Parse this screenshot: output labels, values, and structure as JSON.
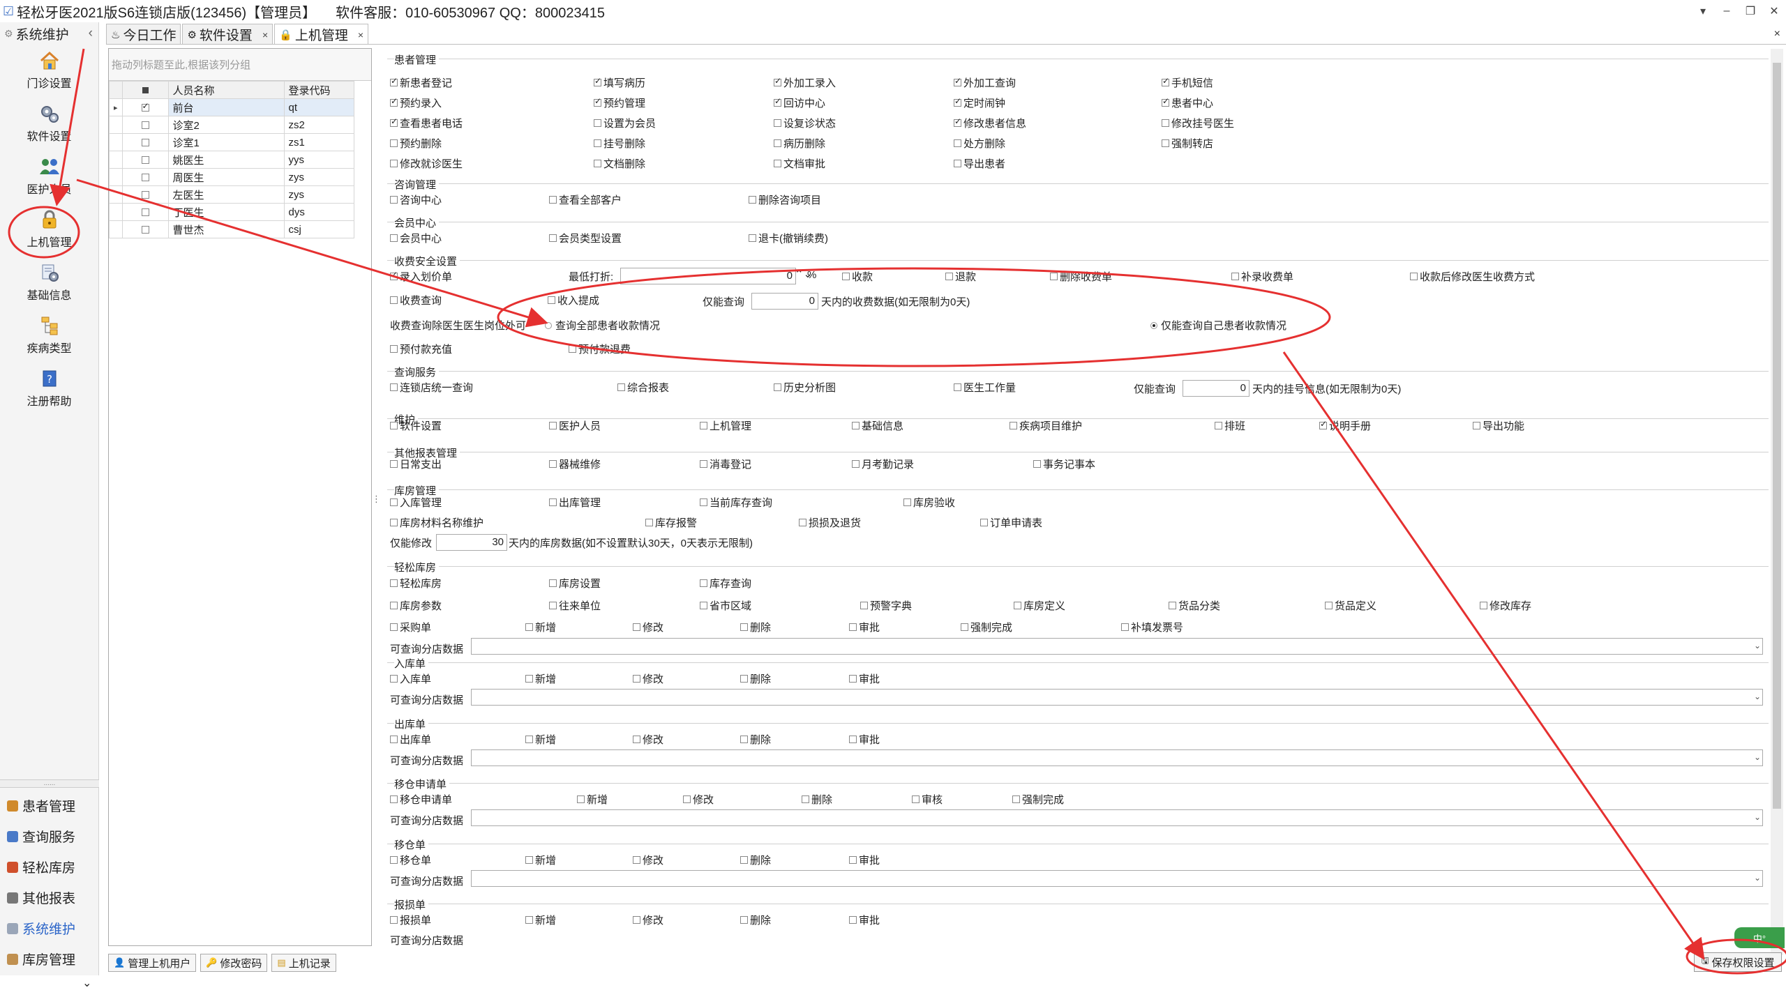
{
  "window": {
    "title": "轻松牙医2021版S6连锁店版(123456)【管理员】",
    "service": "软件客服：010-60530967 QQ：800023415",
    "controls": [
      "▾",
      "–",
      "❐",
      "✕"
    ]
  },
  "sidebar": {
    "header": "系统维护",
    "collapse": "‹",
    "icons": [
      {
        "label": "门诊设置",
        "icon": "house-icon"
      },
      {
        "label": "软件设置",
        "icon": "gears-icon"
      },
      {
        "label": "医护人员",
        "icon": "people-icon"
      },
      {
        "label": "上机管理",
        "icon": "lock-icon"
      },
      {
        "label": "基础信息",
        "icon": "settings-doc-icon"
      },
      {
        "label": "疾病类型",
        "icon": "tree-icon"
      },
      {
        "label": "注册帮助",
        "icon": "help-icon"
      }
    ],
    "grip": "......",
    "modules": [
      "患者管理",
      "查询服务",
      "轻松库房",
      "其他报表",
      "系统维护",
      "库房管理"
    ],
    "more": "⌄",
    "active_color": "#2a64c8"
  },
  "tabs": [
    {
      "label": "今日工作",
      "closable": false
    },
    {
      "label": "软件设置",
      "closable": true
    },
    {
      "label": "上机管理",
      "closable": true
    }
  ],
  "tabclose": "×",
  "users": {
    "group_hint": "拖动列标题至此,根据该列分组",
    "headers": [
      "人员名称",
      "登录代码"
    ],
    "rows": [
      {
        "name": "前台",
        "code": "qt",
        "checked": true
      },
      {
        "name": "诊室2",
        "code": "zs2",
        "checked": false
      },
      {
        "name": "诊室1",
        "code": "zs1",
        "checked": false
      },
      {
        "name": "姚医生",
        "code": "yys",
        "checked": false
      },
      {
        "name": "周医生",
        "code": "zys",
        "checked": false
      },
      {
        "name": "左医生",
        "code": "zys",
        "checked": false
      },
      {
        "name": "丁医生",
        "code": "dys",
        "checked": false
      },
      {
        "name": "曹世杰",
        "code": "csj",
        "checked": false
      }
    ],
    "current_marker": "▸"
  },
  "buttons": {
    "manage_users": "管理上机用户",
    "change_pwd": "修改密码",
    "login_log": "上机记录",
    "save": "保存权限设置"
  },
  "sections": {
    "patient": {
      "title": "患者管理",
      "items": [
        {
          "t": "新患者登记",
          "c": true
        },
        {
          "t": "填写病历",
          "c": true
        },
        {
          "t": "外加工录入",
          "c": true
        },
        {
          "t": "外加工查询",
          "c": true
        },
        {
          "t": "手机短信",
          "c": true
        },
        {
          "t": "预约录入",
          "c": true
        },
        {
          "t": "预约管理",
          "c": true
        },
        {
          "t": "回访中心",
          "c": true
        },
        {
          "t": "定时闹钟",
          "c": true
        },
        {
          "t": "患者中心",
          "c": true
        },
        {
          "t": "查看患者电话",
          "c": true
        },
        {
          "t": "设置为会员",
          "c": false
        },
        {
          "t": "设复诊状态",
          "c": false
        },
        {
          "t": "修改患者信息",
          "c": true
        },
        {
          "t": "修改挂号医生",
          "c": false
        },
        {
          "t": "预约删除",
          "c": false
        },
        {
          "t": "挂号删除",
          "c": false
        },
        {
          "t": "病历删除",
          "c": false
        },
        {
          "t": "处方删除",
          "c": false
        },
        {
          "t": "强制转店",
          "c": false
        },
        {
          "t": "修改就诊医生",
          "c": false
        },
        {
          "t": "文档删除",
          "c": false
        },
        {
          "t": "文档审批",
          "c": false
        },
        {
          "t": "导出患者",
          "c": false
        }
      ]
    },
    "consult": {
      "title": "咨询管理",
      "items": [
        "咨询中心",
        "查看全部客户",
        "删除咨询项目"
      ]
    },
    "member": {
      "title": "会员中心",
      "items": [
        "会员中心",
        "会员类型设置",
        "退卡(撤销续费)"
      ]
    },
    "fee": {
      "title": "收费安全设置",
      "entry": "录入划价单",
      "min_discount": "最低打折:",
      "min_value": "0",
      "spin": "⌃⌄",
      "pct": "%",
      "row1": [
        "收款",
        "退款",
        "删除收费单",
        "补录收费单",
        "收款后修改医生收费方式"
      ],
      "fee_query": "收费查询",
      "income": "收入提成",
      "only_query": "仅能查询",
      "days_value": "0",
      "days_text": "天内的收费数据(如无限制为0天)",
      "exclude_label": "收费查询除医生医生岗位外可",
      "radio_all": "查询全部患者收款情况",
      "radio_own": "仅能查询自己患者收款情况",
      "prepay": "预付款充值",
      "prepay_refund": "预付款退费"
    },
    "query": {
      "title": "查询服务",
      "items": [
        "连锁店统一查询",
        "综合报表",
        "历史分析图",
        "医生工作量"
      ],
      "only": "仅能查询",
      "days": "0",
      "days_text": "天内的挂号信息(如无限制为0天)"
    },
    "maintain": {
      "title": "维护",
      "items": [
        {
          "t": "软件设置",
          "c": false
        },
        {
          "t": "医护人员",
          "c": false
        },
        {
          "t": "上机管理",
          "c": false
        },
        {
          "t": "基础信息",
          "c": false
        },
        {
          "t": "疾病项目维护",
          "c": false
        },
        {
          "t": "排班",
          "c": false
        },
        {
          "t": "说明手册",
          "c": true
        },
        {
          "t": "导出功能",
          "c": false
        }
      ]
    },
    "reports": {
      "title": "其他报表管理",
      "items": [
        "日常支出",
        "器械维修",
        "消毒登记",
        "月考勤记录",
        "事务记事本"
      ]
    },
    "store": {
      "title": "库房管理",
      "row1": [
        "入库管理",
        "出库管理",
        "当前库存查询",
        "库房验收"
      ],
      "row2": [
        "库房材料名称维护",
        "库存报警",
        "损损及退货",
        "订单申请表"
      ],
      "only_modify": "仅能修改",
      "days": "30",
      "days_text": "天内的库房数据(如不设置默认30天，0天表示无限制)"
    },
    "easystore": {
      "title": "轻松库房",
      "row1": [
        "轻松库房",
        "库房设置",
        "库存查询"
      ],
      "row2": [
        "库房参数",
        "往来单位",
        "省市区域",
        "预警字典",
        "库房定义",
        "货品分类",
        "货品定义",
        "修改库存"
      ],
      "row3": [
        "采购单",
        "新增",
        "修改",
        "删除",
        "审批",
        "强制完成",
        "补填发票号"
      ],
      "branch": "可查询分店数据"
    },
    "subs": [
      {
        "title": "入库单",
        "items": [
          "入库单",
          "新增",
          "修改",
          "删除",
          "审批"
        ]
      },
      {
        "title": "出库单",
        "items": [
          "出库单",
          "新增",
          "修改",
          "删除",
          "审批"
        ]
      },
      {
        "title": "移仓申请单",
        "items": [
          "移仓申请单",
          "新增",
          "修改",
          "删除",
          "审核",
          "强制完成"
        ]
      },
      {
        "title": "移仓单",
        "items": [
          "移仓单",
          "新增",
          "修改",
          "删除",
          "审批"
        ]
      },
      {
        "title": "报损单",
        "items": [
          "报损单",
          "新增",
          "修改",
          "删除",
          "审批"
        ]
      }
    ],
    "branch_label": "可查询分店数据",
    "cut_label": "可查询分店数据"
  },
  "badge": "中°",
  "annotation_color": "#e53030"
}
